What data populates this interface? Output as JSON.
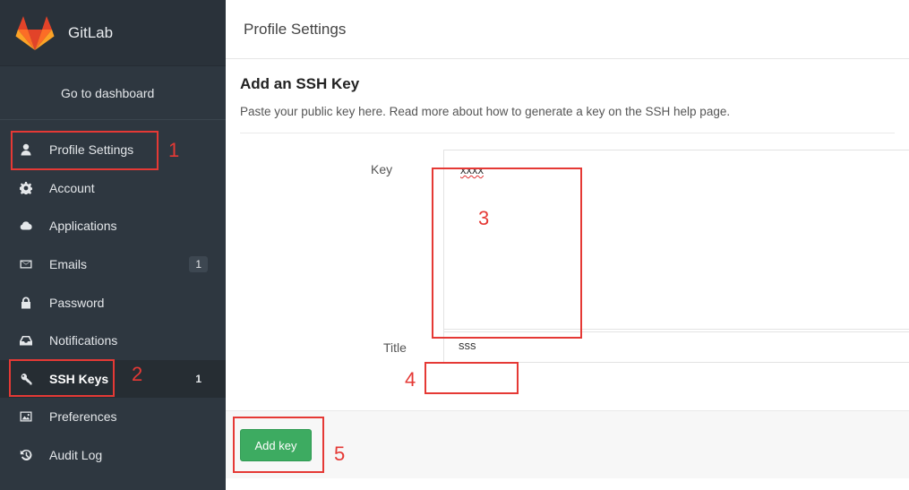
{
  "app": {
    "title": "GitLab"
  },
  "sidebar": {
    "dashboard_link": "Go to dashboard",
    "items": [
      {
        "label": "Profile Settings",
        "icon": "user-icon",
        "badge": ""
      },
      {
        "label": "Account",
        "icon": "gear-icon",
        "badge": ""
      },
      {
        "label": "Applications",
        "icon": "cloud-icon",
        "badge": ""
      },
      {
        "label": "Emails",
        "icon": "envelope-icon",
        "badge": "1"
      },
      {
        "label": "Password",
        "icon": "lock-icon",
        "badge": ""
      },
      {
        "label": "Notifications",
        "icon": "inbox-icon",
        "badge": ""
      },
      {
        "label": "SSH Keys",
        "icon": "key-icon",
        "badge": "1"
      },
      {
        "label": "Preferences",
        "icon": "image-icon",
        "badge": ""
      },
      {
        "label": "Audit Log",
        "icon": "history-icon",
        "badge": ""
      }
    ],
    "active_item": "SSH Keys"
  },
  "header": {
    "title": "Profile Settings"
  },
  "form": {
    "heading": "Add an SSH Key",
    "description": "Paste your public key here. Read more about how to generate a key on the SSH help page.",
    "key_label": "Key",
    "key_value": "xxxx",
    "title_label": "Title",
    "title_value": "sss",
    "submit_label": "Add key"
  },
  "annotations": {
    "color": "#e53935",
    "numbers": [
      "1",
      "2",
      "3",
      "4",
      "5"
    ]
  }
}
